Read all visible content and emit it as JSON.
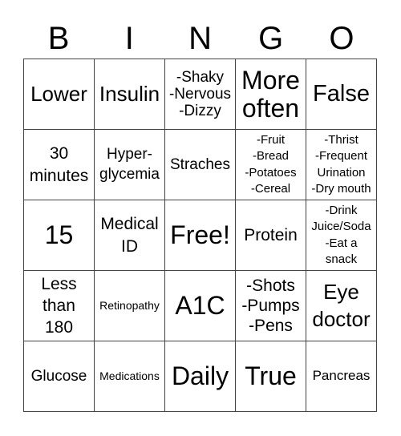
{
  "header": {
    "letters": [
      "B",
      "I",
      "N",
      "G",
      "O"
    ]
  },
  "cells": [
    "Lower",
    "Insulin",
    "-Shaky\n-Nervous\n-Dizzy",
    "More\noften",
    "False",
    "30\nminutes",
    "Hyper-\nglycemia",
    "Straches",
    "-Fruit\n-Bread\n-Potatoes\n-Cereal",
    "-Thrist\n-Frequent\nUrination\n-Dry mouth",
    "15",
    "Medical\nID",
    "Free!",
    "Protein",
    "-Drink\nJuice/Soda\n-Eat a\nsnack",
    "Less\nthan\n180",
    "Retinopathy",
    "A1C",
    "-Shots\n-Pumps\n-Pens",
    "Eye\ndoctor",
    "Glucose",
    "Medications",
    "Daily",
    "True",
    "Pancreas"
  ]
}
